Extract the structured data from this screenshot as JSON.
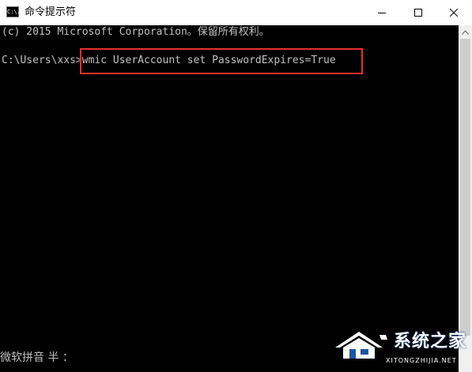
{
  "window": {
    "title": "命令提示符",
    "icon_label": "C:\\.",
    "icon": "cmd-icon"
  },
  "controls": {
    "minimize_icon": "minimize-icon",
    "maximize_icon": "maximize-icon",
    "close_icon": "close-icon"
  },
  "console": {
    "copyright_line": "(c) 2015 Microsoft Corporation。保留所有权利。",
    "prompt": "C:\\Users\\xxs>",
    "command": "wmic UserAccount set PasswordExpires=True",
    "ime_status": "微软拼音 半 ："
  },
  "highlight": {
    "color": "#e8302a"
  },
  "watermark": {
    "brand": "系统之家",
    "url": "XITONGZHIJIA.NET"
  },
  "colors": {
    "console_background": "#000000",
    "console_text": "#c0c0c0",
    "titlebar": "#ffffff"
  }
}
